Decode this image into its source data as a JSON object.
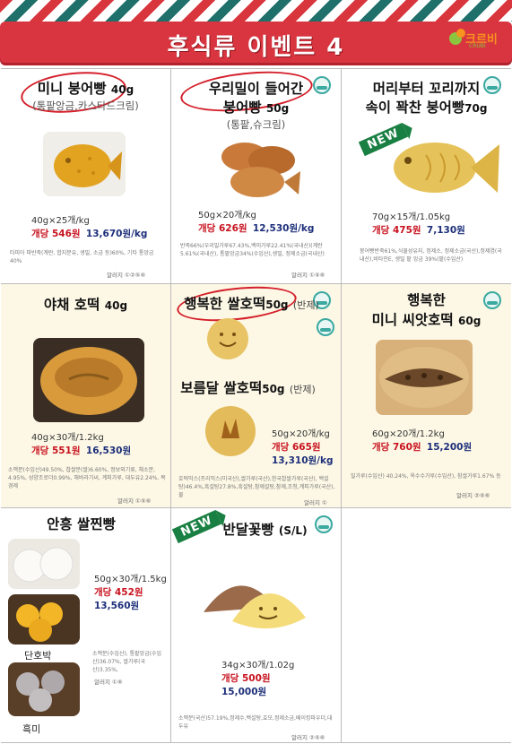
{
  "header": {
    "title": "후식류 이벤트 4",
    "brand": "크르비",
    "brand_sub": "CRUBI"
  },
  "products": [
    {
      "name": "미니 붕어빵",
      "weight": "40g",
      "sub": "(통팥앙금,카스타드크림)",
      "spec": "40g×25개/kg",
      "unit_price": "개당 546원",
      "box_price": "13,670원/kg",
      "ingredients": "타피아 파반죽(계란, 합지분유, 생밀, 소금 등)60%, 기타 통앙금40%",
      "allergy": "알러지 ①②⑤⑥"
    },
    {
      "name": "우리밀이 들어간",
      "name2": "붕어빵",
      "weight": "50g",
      "sub": "(통팥,슈크림)",
      "spec": "50g×20개/kg",
      "unit_price": "개당 626원",
      "box_price": "12,530원/kg",
      "ingredients": "반죽66%(우리밀가루67.43%,백미가루22.41%(국내산)(계란5.61%(국내산), 통팥앙금34%(수입산),생밀, 정제소금(국내산)",
      "allergy": "알러지 ①⑤⑥"
    },
    {
      "name": "머리부터 꼬리까지",
      "name2": "속이 꽉찬 붕어빵",
      "weight": "70g",
      "badge": "NEW",
      "spec": "70g×15개/1.05kg",
      "unit_price": "개당 475원",
      "box_price": "7,130원",
      "ingredients": "붕어빵반죽61%,식물성유지, 정제소, 정제소금(국산),정제염(국내산),비타민E, 생밀 팥 앙금 39%(팥(수입산)",
      "allergy": ""
    },
    {
      "name": "야채 호떡",
      "weight": "40g",
      "spec": "40g×30개/1.2kg",
      "unit_price": "개당 551원",
      "box_price": "16,530원",
      "ingredients": "소맥분(수입산)49.50%, 찹쌀분(쌀)6.60%, 정보외기류, 채소분, 4.95%, 성양조로더0.99%, 해바라기씨, 계피가루, 대두유2.24%, 목경제",
      "allergy": "알러지 ①⑤⑥"
    },
    {
      "name": "행복한 쌀호떡",
      "weight": "50g",
      "sub_inline": "(반제)",
      "name_b": "보름달 쌀호떡",
      "weight_b": "50g",
      "sub_b": "(반제)",
      "spec": "50g×20개/kg",
      "unit_price": "개당 665원",
      "box_price": "13,310원/kg",
      "ingredients": "호떡믹스(프리믹스(미국산),쌀가루(국산),한국찹쌀가루(국산), 백설탕)46.4%,흑설탕27.8%,흑설탕,참깨설탕,참깨,조청,계피가루(국산),물",
      "allergy": "알러지 ①"
    },
    {
      "name": "행복한",
      "name2": "미니 씨앗호떡",
      "weight": "60g",
      "spec": "60g×20개/1.2kg",
      "unit_price": "개당 760원",
      "box_price": "15,200원",
      "ingredients": "밀가루(수입산) 40.24%, 옥수수가루(수입산), 참쌀가루1.67% 등",
      "allergy": "알러지 ②⑤⑥"
    },
    {
      "name": "안흥 쌀찐빵",
      "spec": "50g×30개/1.5kg",
      "unit_price": "개당 452원",
      "box_price": "13,560원",
      "ingredients": "소맥분(수입산), 통팥앙금(수입산)36.07%, 쌀가루(국산)3.35%,",
      "allergy": "알러지 ①⑥",
      "captions": [
        "단호박",
        "흑미"
      ]
    },
    {
      "name": "반달꽃빵",
      "weight": "(S/L)",
      "badge": "NEW",
      "spec": "34g×30개/1.02g",
      "unit_price": "개당 500원",
      "box_price": "15,000원",
      "ingredients": "소맥분(국산)57.19%,정제수,백설탕,효모,정제소금,베이킹파우더,대두유",
      "allergy": "알러지 ②⑤⑥"
    }
  ],
  "colors": {
    "banner": "#d83540",
    "price_red": "#c8121f",
    "price_blue": "#1d2f7a",
    "cream": "#fdf8e6",
    "new_green": "#1a7f42"
  }
}
